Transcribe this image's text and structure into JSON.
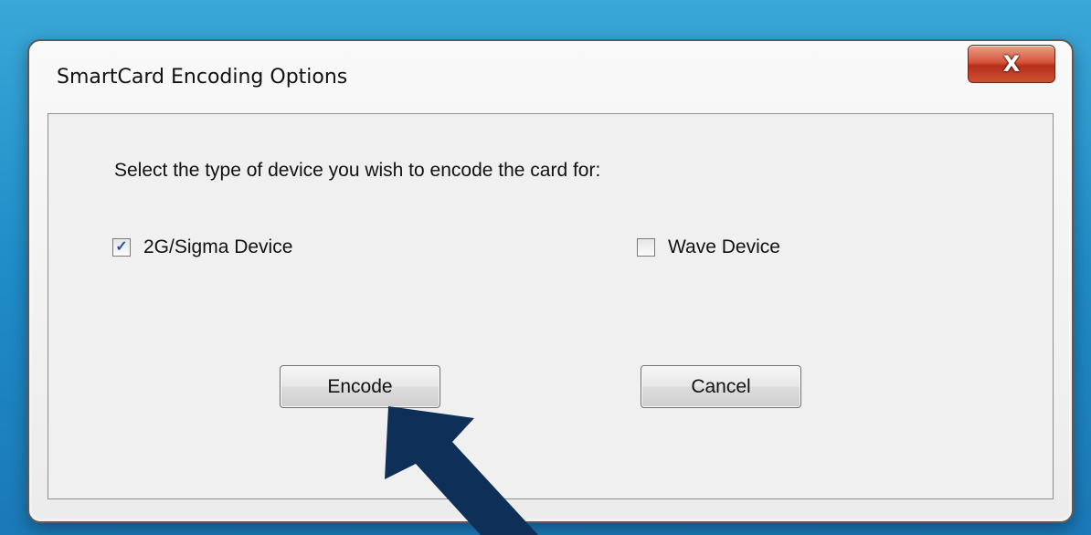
{
  "dialog": {
    "title": "SmartCard Encoding Options",
    "close_glyph": "X",
    "prompt": "Select the type of device you wish to encode the card for:",
    "options": [
      {
        "label": "2G/Sigma Device",
        "checked": true,
        "check_glyph": "✓"
      },
      {
        "label": "Wave Device",
        "checked": false,
        "check_glyph": ""
      }
    ],
    "buttons": {
      "encode": "Encode",
      "cancel": "Cancel"
    }
  },
  "colors": {
    "background": "#2a98cf",
    "arrow": "#0e2f58",
    "close_button": "#d6563b"
  },
  "icons": {
    "close": "close-icon",
    "pointer": "pointer-arrow-icon"
  }
}
